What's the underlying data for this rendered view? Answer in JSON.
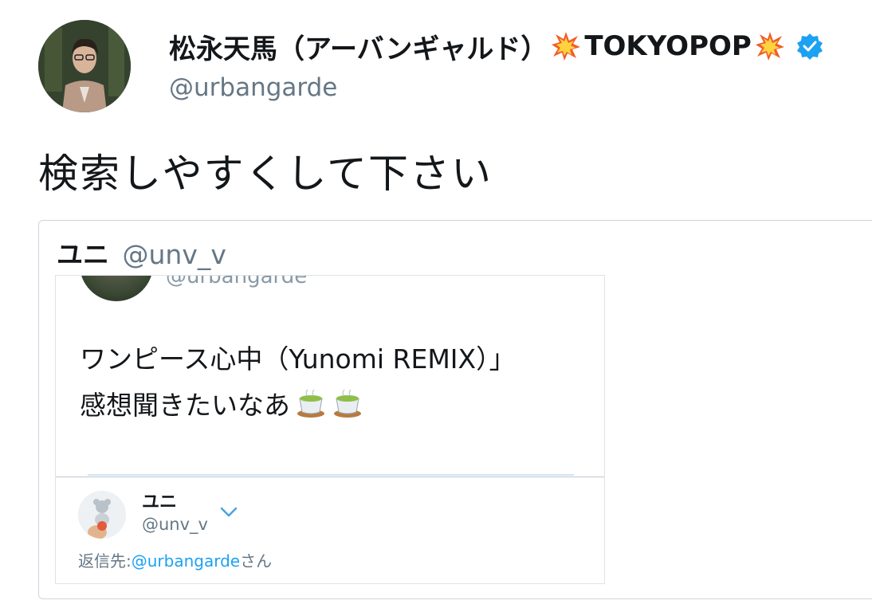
{
  "tweet": {
    "author": {
      "display_name": "松永天馬（アーバンギャルド）",
      "name_suffix": "TOKYOPOP",
      "handle": "@urbangarde",
      "verified": true
    },
    "text": "検索しやすくして下さい",
    "quoted": {
      "author_name": "ユニ",
      "author_handle": "@unv_v",
      "screenshot": {
        "handle": "@urbangarde",
        "line1": "ワンピース心中（Yunomi REMIX）」",
        "line2": "感想聞きたいなあ",
        "emoji": [
          "teacup-icon",
          "teacup-icon"
        ],
        "reply": {
          "name": "ユニ",
          "handle": "@unv_v",
          "reply_prefix": "返信先:",
          "reply_mention": "@urbangarde",
          "reply_suffix": "さん"
        }
      }
    }
  },
  "colors": {
    "text": "#14171a",
    "secondary": "#657786",
    "link": "#1da1f2",
    "border": "#ccd6dd"
  }
}
